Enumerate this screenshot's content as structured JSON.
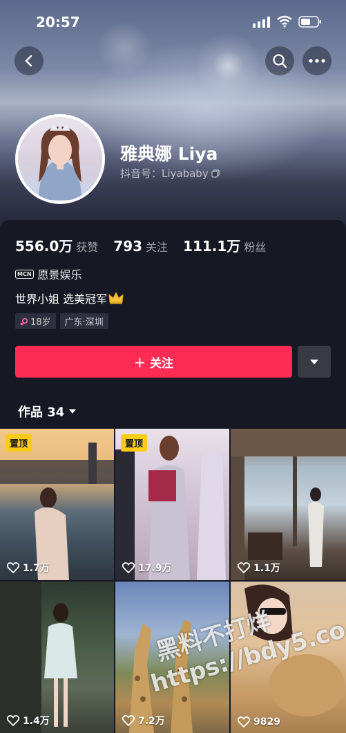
{
  "status_bar": {
    "time": "20:57"
  },
  "profile": {
    "name": "雅典娜 Liya",
    "douyin_id": "抖音号：Liyababy"
  },
  "stats": [
    {
      "value": "556.0万",
      "label": "获赞"
    },
    {
      "value": "793",
      "label": "关注"
    },
    {
      "value": "111.1万",
      "label": "粉丝"
    }
  ],
  "mcn": {
    "badge": "MCN",
    "name": "愿景娱乐"
  },
  "bio": "世界小姐 选美冠军",
  "tags": [
    {
      "text": "18岁",
      "icon": "female-icon"
    },
    {
      "text": "广东·深圳"
    }
  ],
  "follow_button": {
    "label": "关注",
    "icon": "plus-icon"
  },
  "works_tab": {
    "label": "作品 34"
  },
  "grid": [
    {
      "pinned": true,
      "pin_label": "置顶",
      "likes": "1.7万"
    },
    {
      "pinned": true,
      "pin_label": "置顶",
      "likes": "17.9万"
    },
    {
      "pinned": false,
      "likes": "1.1万"
    },
    {
      "pinned": false,
      "likes": "1.4万"
    },
    {
      "pinned": false,
      "likes": "7.2万"
    },
    {
      "pinned": false,
      "likes": "9829"
    }
  ],
  "watermark": {
    "line1": "黑料不打烊",
    "line2": "https://bdy5.co"
  },
  "colors": {
    "accent": "#fe2c55",
    "background": "#161823",
    "pin": "#facc15"
  }
}
